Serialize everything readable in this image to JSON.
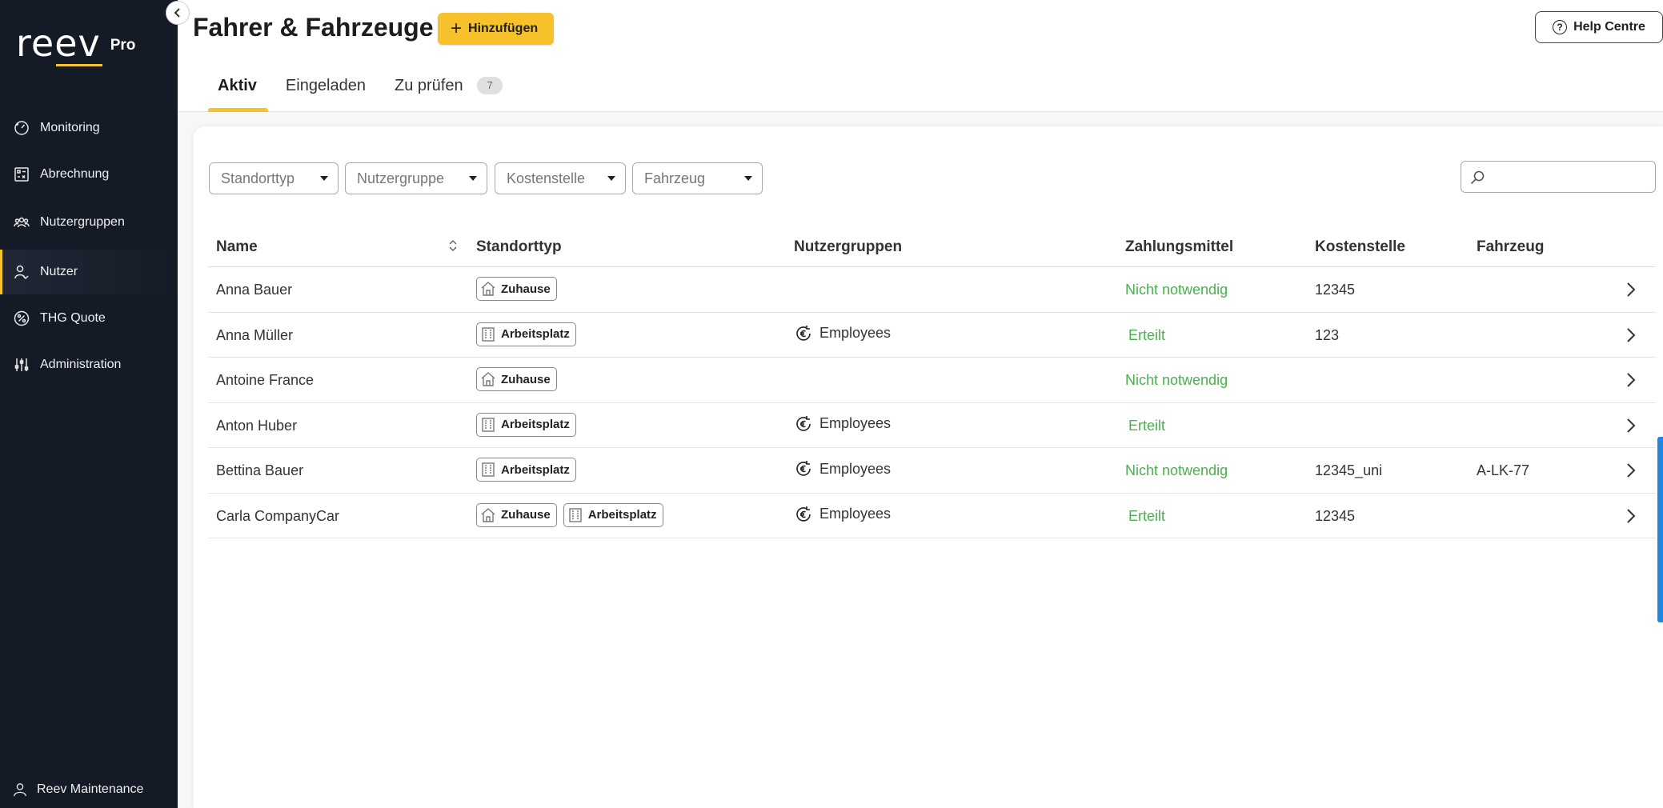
{
  "app": {
    "logo_text": "reev",
    "logo_suffix": "Pro"
  },
  "sidebar": {
    "items": [
      {
        "label": "Monitoring",
        "icon": "gauge-icon"
      },
      {
        "label": "Abrechnung",
        "icon": "billing-icon"
      },
      {
        "label": "Nutzergruppen",
        "icon": "user-groups-icon"
      },
      {
        "label": "Nutzer",
        "icon": "user-icon",
        "active": true
      },
      {
        "label": "THG Quote",
        "icon": "percent-icon"
      },
      {
        "label": "Administration",
        "icon": "sliders-icon"
      }
    ],
    "user": "Reev Maintenance"
  },
  "header": {
    "title": "Fahrer & Fahrzeuge",
    "add_label": "Hinzufügen",
    "help_label": "Help Centre"
  },
  "tabs": [
    {
      "label": "Aktiv",
      "active": true
    },
    {
      "label": "Eingeladen"
    },
    {
      "label": "Zu prüfen",
      "badge": "7"
    }
  ],
  "filters": {
    "standorttyp": "Standorttyp",
    "nutzergruppe": "Nutzergruppe",
    "kostenstelle": "Kostenstelle",
    "fahrzeug": "Fahrzeug",
    "search_placeholder": ""
  },
  "table": {
    "headers": {
      "name": "Name",
      "standorttyp": "Standorttyp",
      "nutzergruppen": "Nutzergruppen",
      "zahlungsmittel": "Zahlungsmittel",
      "kostenstelle": "Kostenstelle",
      "fahrzeug": "Fahrzeug"
    },
    "rows": [
      {
        "name": "Anna Bauer",
        "locations": [
          "Zuhause"
        ],
        "group": "",
        "payment": "Nicht notwendig",
        "cost_center": "12345",
        "vehicle": ""
      },
      {
        "name": "Anna Müller",
        "locations": [
          "Arbeitsplatz"
        ],
        "group": "Employees",
        "payment": "Erteilt",
        "cost_center": "123",
        "vehicle": ""
      },
      {
        "name": "Antoine France",
        "locations": [
          "Zuhause"
        ],
        "group": "",
        "payment": "Nicht notwendig",
        "cost_center": "",
        "vehicle": ""
      },
      {
        "name": "Anton Huber",
        "locations": [
          "Arbeitsplatz"
        ],
        "group": "Employees",
        "payment": "Erteilt",
        "cost_center": "",
        "vehicle": ""
      },
      {
        "name": "Bettina Bauer",
        "locations": [
          "Arbeitsplatz"
        ],
        "group": "Employees",
        "payment": "Nicht notwendig",
        "cost_center": "12345_uni",
        "vehicle": "A-LK-77"
      },
      {
        "name": "Carla CompanyCar",
        "locations": [
          "Zuhause",
          "Arbeitsplatz"
        ],
        "group": "Employees",
        "payment": "Erteilt",
        "cost_center": "12345",
        "vehicle": ""
      }
    ]
  },
  "colors": {
    "accent": "#f7c12b",
    "sidebar_bg": "#141b26",
    "status_green": "#4caf50",
    "scroll_indicator": "#1e88e5"
  }
}
